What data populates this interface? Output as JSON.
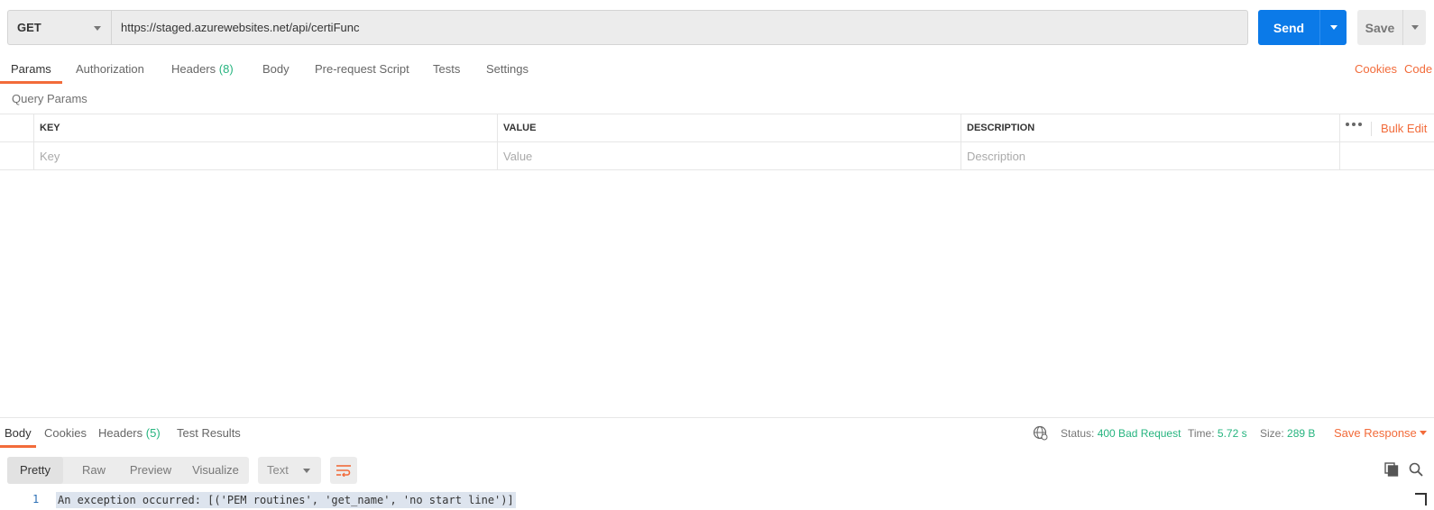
{
  "request": {
    "method": "GET",
    "url": "https://staged.azurewebsites.net/api/certiFunc",
    "send_label": "Send",
    "save_label": "Save"
  },
  "request_tabs": [
    {
      "label": "Params",
      "count": ""
    },
    {
      "label": "Authorization",
      "count": ""
    },
    {
      "label": "Headers",
      "count": "(8)"
    },
    {
      "label": "Body",
      "count": ""
    },
    {
      "label": "Pre-request Script",
      "count": ""
    },
    {
      "label": "Tests",
      "count": ""
    },
    {
      "label": "Settings",
      "count": ""
    }
  ],
  "links": {
    "cookies": "Cookies",
    "code": "Code"
  },
  "query_params": {
    "title": "Query Params",
    "columns": [
      "KEY",
      "VALUE",
      "DESCRIPTION"
    ],
    "placeholders": [
      "Key",
      "Value",
      "Description"
    ],
    "bulk_edit": "Bulk Edit"
  },
  "response_tabs": [
    {
      "label": "Body",
      "count": ""
    },
    {
      "label": "Cookies",
      "count": ""
    },
    {
      "label": "Headers",
      "count": "(5)"
    },
    {
      "label": "Test Results",
      "count": ""
    }
  ],
  "response_meta": {
    "status_label": "Status:",
    "status_value": "400 Bad Request",
    "time_label": "Time:",
    "time_value": "5.72 s",
    "size_label": "Size:",
    "size_value": "289 B",
    "save_response": "Save Response"
  },
  "formats": [
    "Pretty",
    "Raw",
    "Preview",
    "Visualize"
  ],
  "language": "Text",
  "response_body": {
    "line_number": "1",
    "text": "An exception occurred: [('PEM routines', 'get_name', 'no start line')]"
  },
  "colors": {
    "accent": "#f26b3a",
    "send_blue": "#0b7ae8",
    "success_green": "#26b47f"
  }
}
